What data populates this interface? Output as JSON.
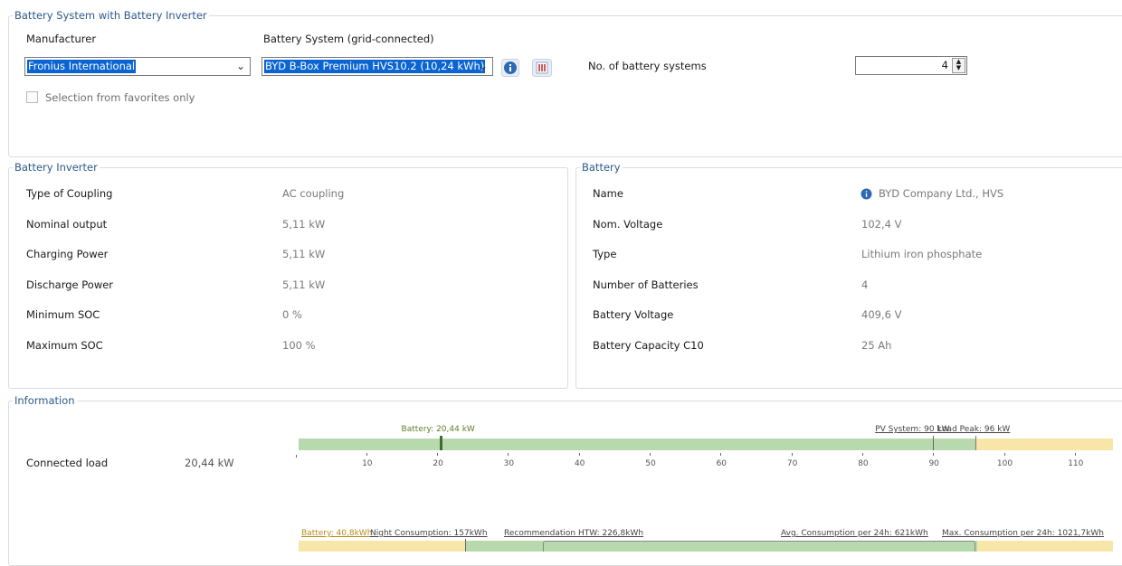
{
  "system": {
    "legend": "Battery System with Battery Inverter",
    "manufacturer_label": "Manufacturer",
    "manufacturer_value": "Fronius International",
    "battery_system_label": "Battery System (grid-connected)",
    "battery_system_value": "BYD B-Box Premium HVS10.2 (10,24 kWh)",
    "favorites_label": "Selection from favorites only",
    "favorites_checked": false,
    "num_systems_label": "No. of battery systems",
    "num_systems_value": "4"
  },
  "inverter": {
    "legend": "Battery Inverter",
    "rows": [
      {
        "label": "Type of Coupling",
        "value": "AC coupling"
      },
      {
        "label": "Nominal output",
        "value": "5,11 kW"
      },
      {
        "label": "Charging Power",
        "value": "5,11 kW"
      },
      {
        "label": "Discharge Power",
        "value": "5,11 kW"
      },
      {
        "label": "Minimum SOC",
        "value": "0 %"
      },
      {
        "label": "Maximum SOC",
        "value": "100 %"
      }
    ]
  },
  "battery": {
    "legend": "Battery",
    "rows": [
      {
        "label": "Name",
        "value": "BYD Company Ltd., HVS"
      },
      {
        "label": "Nom. Voltage",
        "value": "102,4 V"
      },
      {
        "label": "Type",
        "value": "Lithium iron phosphate"
      },
      {
        "label": "Number of Batteries",
        "value": "4"
      },
      {
        "label": "Battery Voltage",
        "value": "409,6 V"
      },
      {
        "label": "Battery Capacity C10",
        "value": "25 Ah"
      }
    ]
  },
  "information": {
    "legend": "Information",
    "connected_load_label": "Connected load",
    "connected_load_value": "20,44 kW",
    "load_chart": {
      "axis_min": 0,
      "axis_max": 115,
      "ticks": [
        "10",
        "20",
        "30",
        "40",
        "50",
        "60",
        "70",
        "80",
        "90",
        "100",
        "110"
      ],
      "battery_label": "Battery: 20,44 kW",
      "battery_value": 20.44,
      "pv_label": "PV System: 90 kW",
      "pv_value": 90,
      "peak_label": "Load Peak: 96 kW",
      "peak_value": 96,
      "green_color": "#b8d9ad",
      "yellow_color": "#f8e6a8",
      "marker_color": "#3d6b33"
    },
    "energy_chart": {
      "battery_label": "Battery: 40,8kWh",
      "night_label": "Night Consumption: 157kWh",
      "htw_label": "Recommendation HTW: 226,8kWh",
      "avg_label": "Avg. Consumption per 24h: 621kWh",
      "max_label": "Max. Consumption per 24h: 1021,7kWh"
    }
  }
}
